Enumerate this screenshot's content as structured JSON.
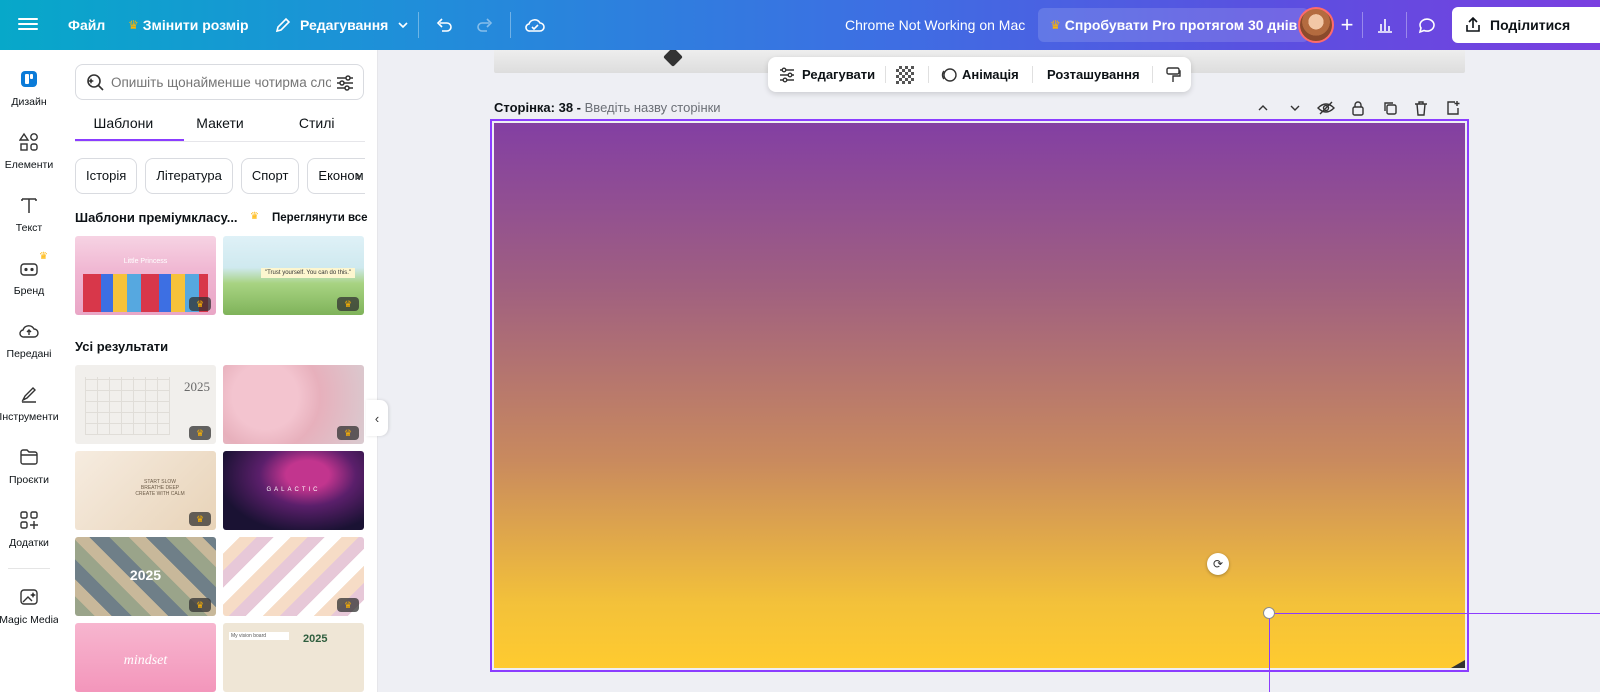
{
  "topbar": {
    "file": "Файл",
    "resize": "Змінити розмір",
    "edit": "Редагування",
    "doc_title": "Chrome Not Working on Mac",
    "pro_trial": "Спробувати Pro протягом 30 днів",
    "share": "Поділитися",
    "icons": [
      "menu-icon",
      "undo-icon",
      "redo-icon",
      "cloud-save-icon",
      "plus-icon",
      "chart-icon",
      "comment-icon",
      "share-icon"
    ]
  },
  "rail": {
    "items": [
      {
        "label": "Дизайн",
        "icon": "design-icon"
      },
      {
        "label": "Елементи",
        "icon": "elements-icon"
      },
      {
        "label": "Текст",
        "icon": "text-icon"
      },
      {
        "label": "Бренд",
        "icon": "brand-icon"
      },
      {
        "label": "Передані",
        "icon": "uploads-icon"
      },
      {
        "label": "Інструменти",
        "icon": "tools-icon"
      },
      {
        "label": "Проєкти",
        "icon": "projects-icon"
      },
      {
        "label": "Додатки",
        "icon": "apps-icon"
      },
      {
        "label": "Magic Media",
        "icon": "magic-media-icon"
      }
    ]
  },
  "panel": {
    "search_placeholder": "Опишіть щонайменше чотирма сло",
    "tabs": [
      "Шаблони",
      "Макети",
      "Стилі"
    ],
    "chips": [
      "Історія",
      "Література",
      "Спорт",
      "Економ"
    ],
    "premium_title": "Шаблони преміумкласу...",
    "see_all": "Переглянути все",
    "all_results": "Усі результати",
    "thumb_texts": {
      "princess": "Little Princess",
      "trust": "\"Trust yourself. You can do this.\"",
      "year": "2025",
      "galactic": "GALACTIC",
      "slow": "START SLOW\nBREATHE DEEP\nCREATE WITH CALM",
      "mindset": "mindset",
      "vision": "My vision board"
    }
  },
  "canvas": {
    "context_toolbar": {
      "edit": "Редагувати",
      "animation": "Анімація",
      "position": "Розташування"
    },
    "page_number_label": "Сторінка: 38 -",
    "page_name_placeholder": "Введіть назву сторінки",
    "accent": "#8b3dff"
  }
}
